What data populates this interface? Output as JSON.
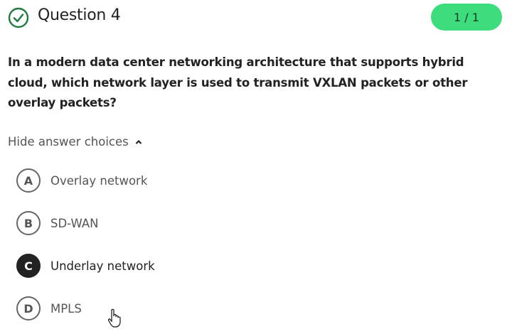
{
  "header": {
    "title": "Question 4",
    "score": "1 / 1",
    "status_icon": "check-circle-icon",
    "accent": "#3ddc7c",
    "check_color": "#1e7a3e"
  },
  "question": {
    "text": "In a modern data center networking architecture that supports hybrid cloud, which network layer is used to transmit VXLAN packets or other overlay packets?"
  },
  "toggle": {
    "label": "Hide answer choices",
    "icon": "chevron-up-icon"
  },
  "options": [
    {
      "letter": "A",
      "label": "Overlay network",
      "selected": false
    },
    {
      "letter": "B",
      "label": "SD-WAN",
      "selected": false
    },
    {
      "letter": "C",
      "label": "Underlay network",
      "selected": true
    },
    {
      "letter": "D",
      "label": "MPLS",
      "selected": false
    }
  ]
}
